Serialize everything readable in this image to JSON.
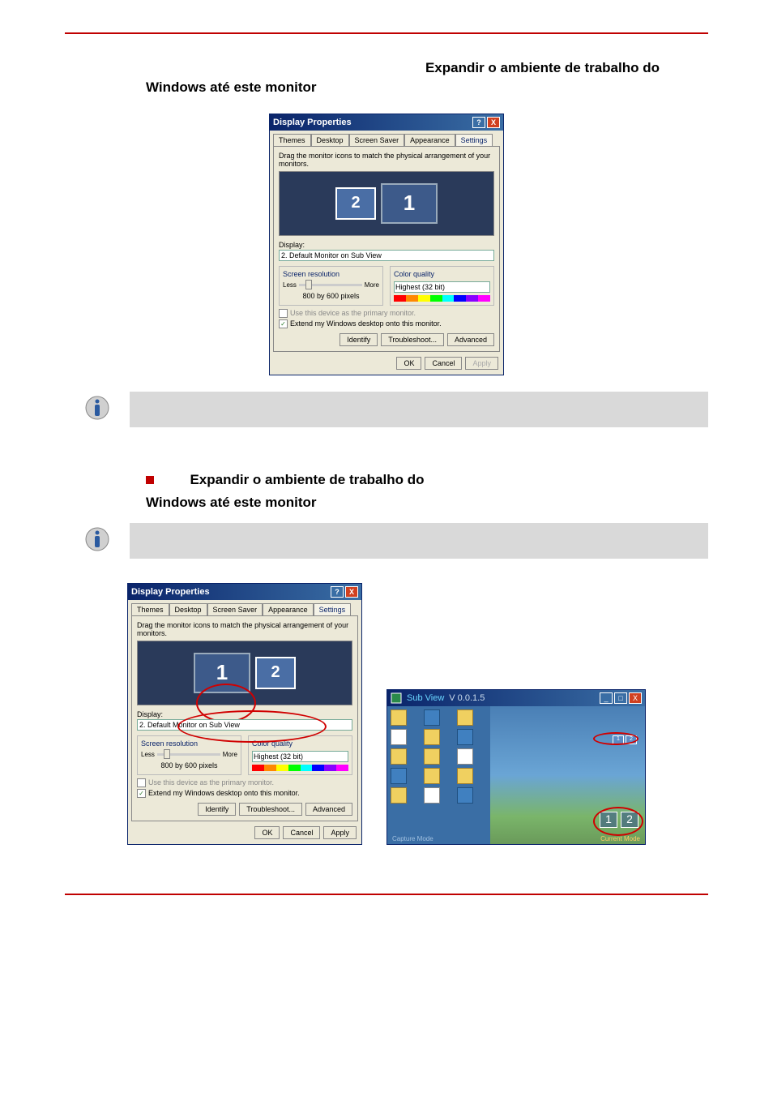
{
  "heading1": {
    "prefix": "",
    "bold_part1": "Expandir o ambiente de trabalho do",
    "bold_part2": "Windows até este monitor"
  },
  "heading2": {
    "bold_part1": "Expandir o ambiente de trabalho do",
    "bold_part2": "Windows até este monitor"
  },
  "dialog1": {
    "title": "Display Properties",
    "tabs": [
      "Themes",
      "Desktop",
      "Screen Saver",
      "Appearance",
      "Settings"
    ],
    "active_tab": "Settings",
    "drag_text": "Drag the monitor icons to match the physical arrangement of your monitors.",
    "monitors": [
      "2",
      "1"
    ],
    "active_monitor": "2",
    "display_label": "Display:",
    "display_value": "2. Default Monitor on Sub View",
    "screen_res_label": "Screen resolution",
    "less": "Less",
    "more": "More",
    "resolution_text": "800 by 600 pixels",
    "color_quality_label": "Color quality",
    "color_quality_value": "Highest (32 bit)",
    "primary_label": "Use this device as the primary monitor.",
    "extend_label": "Extend my Windows desktop onto this monitor.",
    "identify": "Identify",
    "troubleshoot": "Troubleshoot...",
    "advanced": "Advanced",
    "ok": "OK",
    "cancel": "Cancel",
    "apply": "Apply"
  },
  "dialog2": {
    "title": "Display Properties",
    "tabs": [
      "Themes",
      "Desktop",
      "Screen Saver",
      "Appearance",
      "Settings"
    ],
    "active_tab": "Settings",
    "drag_text": "Drag the monitor icons to match the physical arrangement of your monitors.",
    "monitors": [
      "1",
      "2"
    ],
    "active_monitor": "2",
    "display_label": "Display:",
    "display_value": "2. Default Monitor on Sub View",
    "screen_res_label": "Screen resolution",
    "less": "Less",
    "more": "More",
    "resolution_text": "800 by 600 pixels",
    "color_quality_label": "Color quality",
    "color_quality_value": "Highest (32 bit)",
    "primary_label": "Use this device as the primary monitor.",
    "extend_label": "Extend my Windows desktop onto this monitor.",
    "identify": "Identify",
    "troubleshoot": "Troubleshoot...",
    "advanced": "Advanced",
    "ok": "OK",
    "cancel": "Cancel",
    "apply": "Apply"
  },
  "subview": {
    "title": "Sub View",
    "version": "V 0.0.1.5",
    "footer_left": "Capture Mode",
    "footer_right": "Current Mode",
    "mon1": "1",
    "mon2": "2"
  }
}
